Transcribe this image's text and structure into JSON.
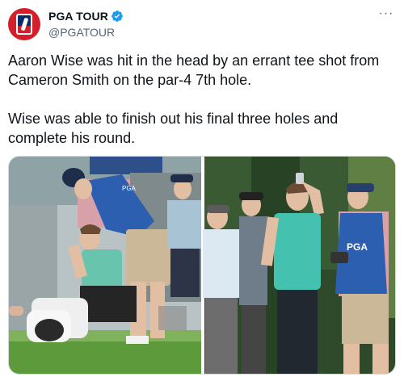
{
  "account": {
    "display_name": "PGA TOUR",
    "handle": "@PGATOUR",
    "verified": true,
    "avatar_icon": "pga-tour-logo",
    "brand_color": "#d31f2a"
  },
  "menu": {
    "icon": "more-options-icon",
    "glyph": "···"
  },
  "tweet": {
    "text": "Aaron Wise was hit in the head by an errant tee shot from Cameron Smith on the par-4 7th hole.\n\nWise was able to finish out his final three holes and complete his round."
  },
  "media": {
    "left_photo": {
      "caddie_bib_text": "PGA"
    },
    "right_photo": {
      "caddie_bib_text": "PGA"
    }
  }
}
